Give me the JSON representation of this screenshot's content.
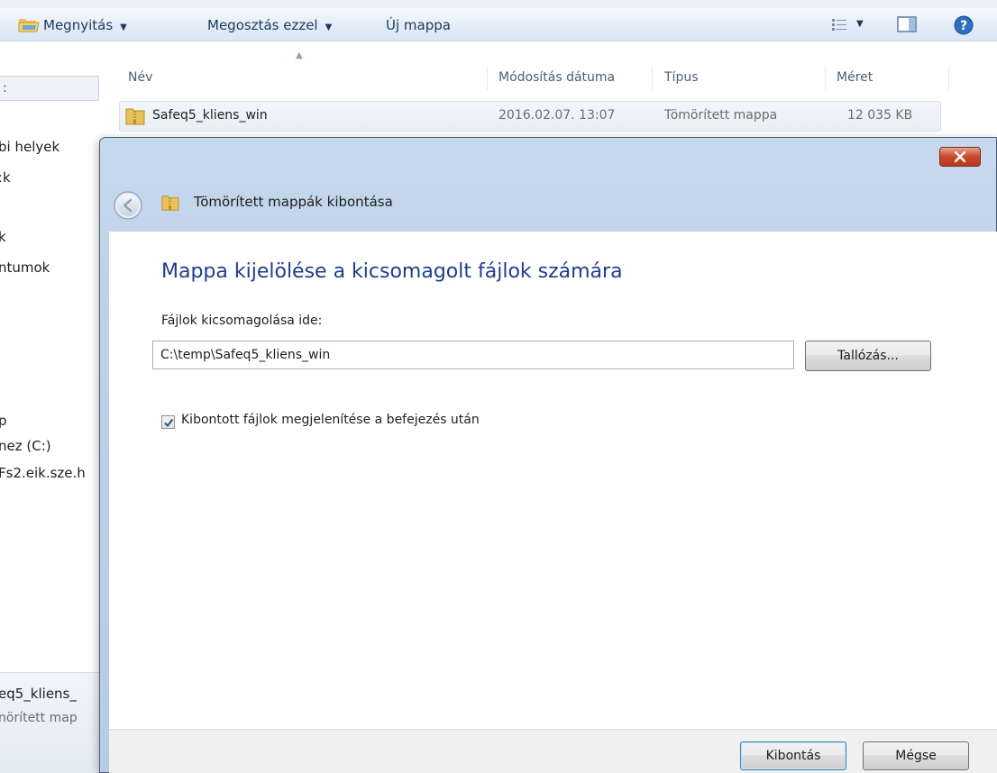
{
  "toolbar": {
    "open_label": "Megnyitás",
    "share_label": "Megosztás ezzel",
    "new_folder_label": "Új mappa",
    "icons": [
      "folder-open-icon",
      "view-options-icon",
      "preview-pane-icon",
      "help-icon"
    ]
  },
  "navpane": {
    "search_fragment": ":",
    "items": [
      "bi helyek",
      "ːk",
      "k",
      "ntumok",
      "p",
      "nez (C:)",
      "Fs2.eik.sze.h"
    ],
    "details_name": "eq5_kliens_",
    "details_type": "nörített map"
  },
  "file_list": {
    "columns": [
      "Név",
      "Módosítás dátuma",
      "Típus",
      "Méret"
    ],
    "rows": [
      {
        "name": "Safeq5_kliens_win",
        "modified": "2016.02.07. 13:07",
        "type": "Tömörített mappa",
        "size": "12 035 KB"
      }
    ]
  },
  "dialog": {
    "title": "Tömörített mappák kibontása",
    "heading": "Mappa kijelölése a kicsomagolt fájlok számára",
    "field_label": "Fájlok kicsomagolása ide:",
    "path_value": "C:\\temp\\Safeq5_kliens_win",
    "browse_label": "Tallózás...",
    "checkbox_label": "Kibontott fájlok megjelenítése a befejezés után",
    "checkbox_checked": true,
    "extract_label": "Kibontás",
    "cancel_label": "Mégse"
  },
  "colors": {
    "heading": "#1e3e8c",
    "close_button": "#c9472b",
    "dialog_frame": "#bdd0e8"
  }
}
